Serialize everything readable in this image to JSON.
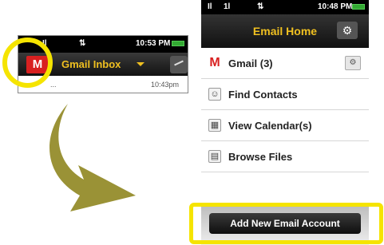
{
  "inbox_preview": {
    "status_time": "10:53 PM",
    "gmail_glyph": "M",
    "title": "Gmail Inbox",
    "row_from": "...",
    "row_time": "10:43pm"
  },
  "status_bar": {
    "signal": "Il",
    "network": "1l",
    "time": "10:48 PM"
  },
  "header": {
    "title": "Email Home",
    "settings_icon": "gear-icon"
  },
  "menu": [
    {
      "label": "Gmail (3)",
      "icon": "gmail-icon",
      "icon_glyph": "M"
    },
    {
      "label": "Find Contacts",
      "icon": "contacts-icon",
      "icon_glyph": "☺"
    },
    {
      "label": "View Calendar(s)",
      "icon": "calendar-icon",
      "icon_glyph": "▦"
    },
    {
      "label": "Browse Files",
      "icon": "file-icon",
      "icon_glyph": "▤"
    }
  ],
  "add_account_label": "Add New Email Account",
  "colors": {
    "accent": "#f0c020",
    "highlight": "#f5e400",
    "gmail_red": "#d82020",
    "arrow": "#9a9236"
  }
}
